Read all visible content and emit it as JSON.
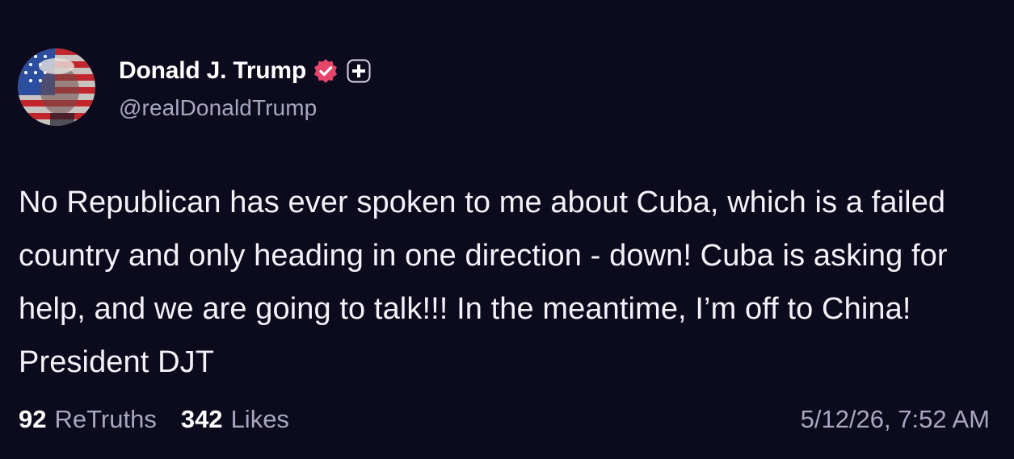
{
  "colors": {
    "background": "#0c0a1d",
    "primary_text": "#f3f2f8",
    "secondary_text": "#a9a6c2",
    "verified_badge": "#e8456a"
  },
  "author": {
    "avatar_icon": "avatar-flag-portrait",
    "display_name": "Donald J. Trump",
    "verified_icon": "verified-badge-icon",
    "plus_icon": "plus-badge-icon",
    "handle": "@realDonaldTrump"
  },
  "post": {
    "text": "No Republican has ever spoken to me about Cuba, which is a failed country and only heading in one direction - down! Cuba is asking for help, and we are going to talk!!! In the meantime, I’m off to China! President DJT"
  },
  "stats": {
    "retruths_count": "92",
    "retruths_label": "ReTruths",
    "likes_count": "342",
    "likes_label": "Likes"
  },
  "timestamp": "5/12/26, 7:52 AM"
}
